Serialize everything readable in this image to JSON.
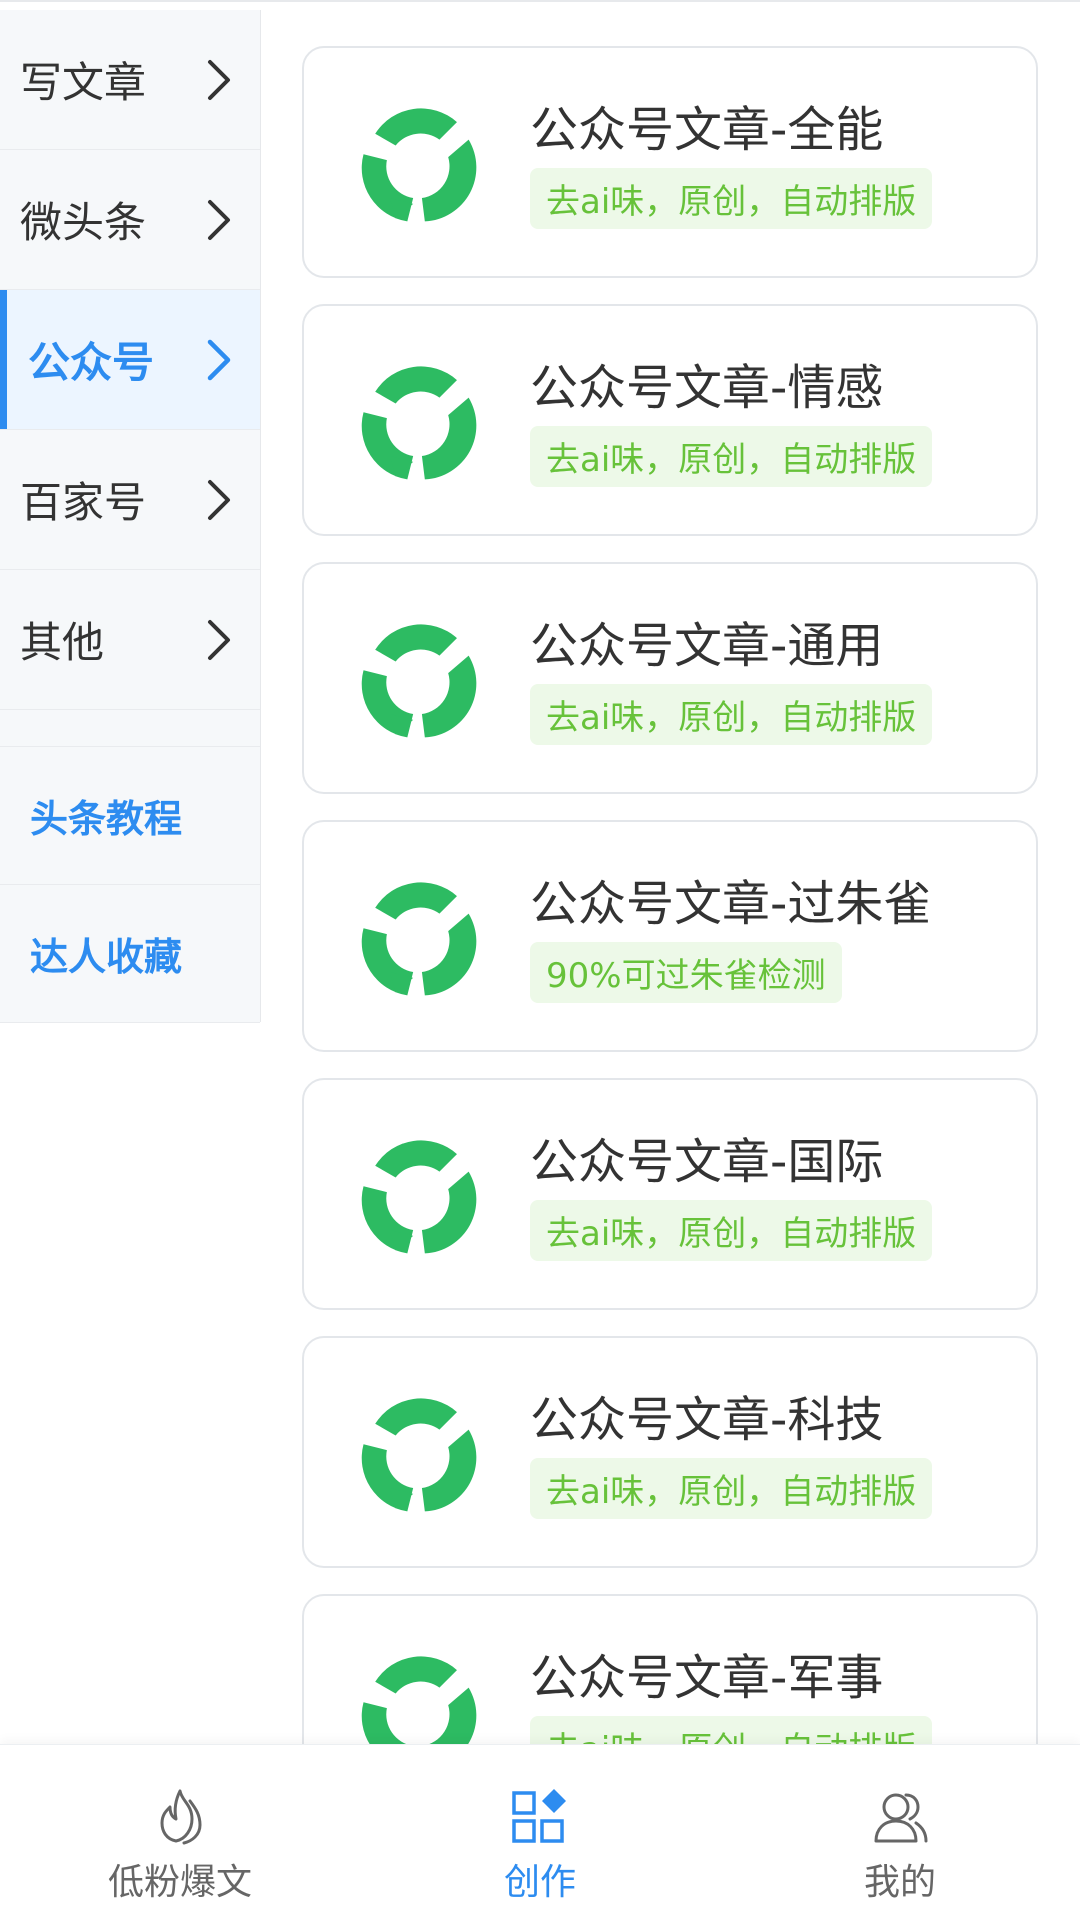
{
  "sidebar": {
    "items": [
      {
        "label": "写文章",
        "active": false
      },
      {
        "label": "微头条",
        "active": false
      },
      {
        "label": "公众号",
        "active": true
      },
      {
        "label": "百家号",
        "active": false
      },
      {
        "label": "其他",
        "active": false
      }
    ],
    "links": [
      {
        "label": "头条教程"
      },
      {
        "label": "达人收藏"
      }
    ]
  },
  "cards": [
    {
      "title": "公众号文章-全能",
      "tag": "去ai味，原创，自动排版"
    },
    {
      "title": "公众号文章-情感",
      "tag": "去ai味，原创，自动排版"
    },
    {
      "title": "公众号文章-通用",
      "tag": "去ai味，原创，自动排版"
    },
    {
      "title": "公众号文章-过朱雀",
      "tag": "90%可过朱雀检测"
    },
    {
      "title": "公众号文章-国际",
      "tag": "去ai味，原创，自动排版"
    },
    {
      "title": "公众号文章-科技",
      "tag": "去ai味，原创，自动排版"
    },
    {
      "title": "公众号文章-军事",
      "tag": "去ai味，原创，自动排版"
    }
  ],
  "bottom_nav": {
    "tabs": [
      {
        "label": "低粉爆文",
        "icon": "flame-icon",
        "active": false
      },
      {
        "label": "创作",
        "icon": "apps-icon",
        "active": true
      },
      {
        "label": "我的",
        "icon": "users-icon",
        "active": false
      }
    ]
  },
  "colors": {
    "accent": "#2d8cf0",
    "tag_green": "#67c23a",
    "tag_bg": "#edf9e8",
    "logo_green": "#2dbb62"
  }
}
